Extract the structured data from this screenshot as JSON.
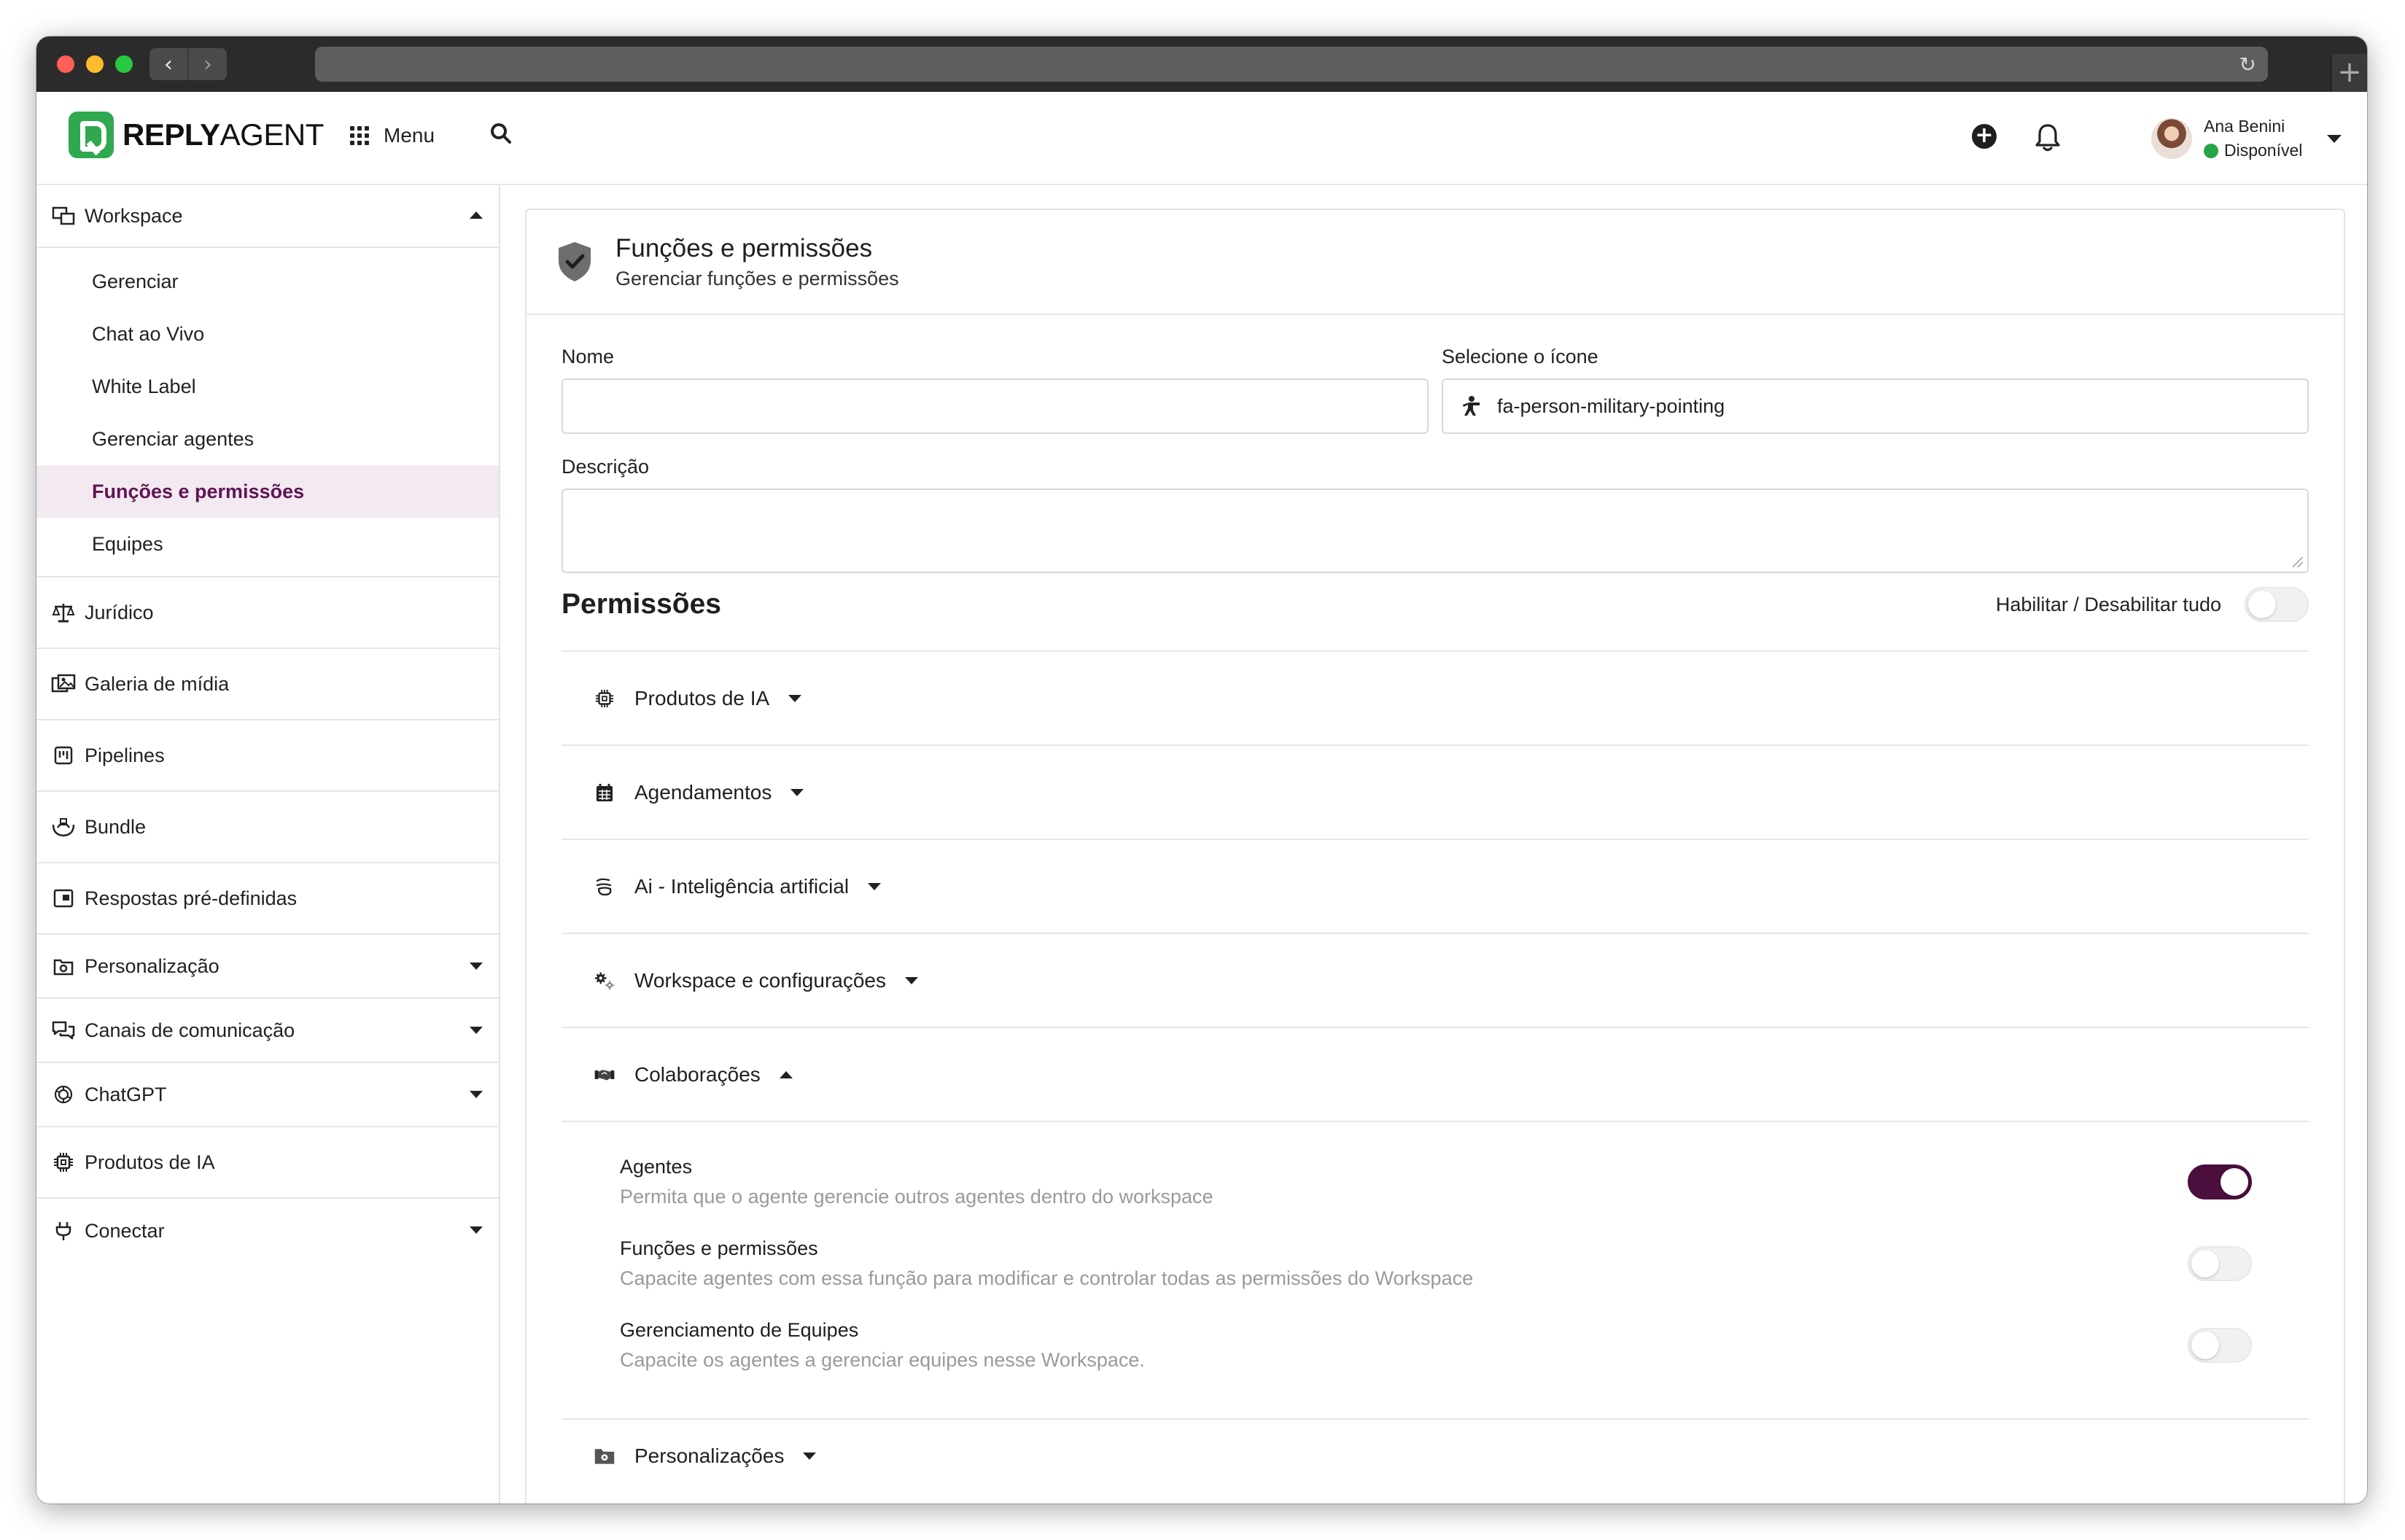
{
  "browser": {
    "back": "‹",
    "forward": "›",
    "reload": "↻",
    "new_tab": "+"
  },
  "header": {
    "brand_bold": "REPLY",
    "brand_light": "AGENT",
    "menu_label": "Menu",
    "user_name": "Ana Benini",
    "user_status": "Disponível",
    "status_color": "#27a445"
  },
  "sidebar": {
    "workspace": {
      "label": "Workspace",
      "items": [
        "Gerenciar",
        "Chat ao Vivo",
        "White Label",
        "Gerenciar agentes",
        "Funções e permissões",
        "Equipes"
      ],
      "active_item": "Funções e permissões"
    },
    "sections": [
      {
        "label": "Jurídico",
        "icon": "scale-icon"
      },
      {
        "label": "Galeria de mídia",
        "icon": "photo-gallery-icon"
      },
      {
        "label": "Pipelines",
        "icon": "pipeline-icon"
      },
      {
        "label": "Bundle",
        "icon": "bundle-icon"
      },
      {
        "label": "Respostas pré-definidas",
        "icon": "canned-response-icon"
      },
      {
        "label": "Personalização",
        "icon": "customize-icon"
      },
      {
        "label": "Canais de comunicação",
        "icon": "chat-channels-icon"
      },
      {
        "label": "ChatGPT",
        "icon": "openai-icon"
      },
      {
        "label": "Produtos de IA",
        "icon": "chip-icon"
      },
      {
        "label": "Conectar",
        "icon": "plug-icon"
      }
    ]
  },
  "main": {
    "title": "Funções e permissões",
    "subtitle": "Gerenciar funções e permissões",
    "form": {
      "name_label": "Nome",
      "name_value": "",
      "icon_label": "Selecione o ícone",
      "icon_value": "fa-person-military-pointing",
      "description_label": "Descrição",
      "description_value": ""
    },
    "permissions": {
      "title": "Permissões",
      "toggle_all_label": "Habilitar / Desabilitar tudo",
      "toggle_all_on": false,
      "groups": [
        {
          "label": "Produtos de IA",
          "icon": "chip-icon",
          "expanded": false
        },
        {
          "label": "Agendamentos",
          "icon": "calendar-icon",
          "expanded": false
        },
        {
          "label": "Ai - Inteligência artificial",
          "icon": "ai-icon",
          "expanded": false
        },
        {
          "label": "Workspace e configurações",
          "icon": "gears-icon",
          "expanded": false
        },
        {
          "label": "Colaborações",
          "icon": "handshake-icon",
          "expanded": true
        },
        {
          "label": "Personalizações",
          "icon": "folder-gear-icon",
          "expanded": false
        }
      ],
      "colaboracoes_items": [
        {
          "name": "Agentes",
          "description": "Permita que o agente gerencie outros agentes dentro do workspace",
          "enabled": true
        },
        {
          "name": "Funções e permissões",
          "description": "Capacite agentes com essa função para modificar e controlar todas as permissões do Workspace",
          "enabled": false
        },
        {
          "name": "Gerenciamento de Equipes",
          "description": "Capacite os agentes a gerenciar equipes nesse Workspace.",
          "enabled": false
        }
      ]
    }
  },
  "colors": {
    "accent": "#4a0f3d",
    "active_bg": "#f3e9f0",
    "active_text": "#5e1555",
    "brand_green": "#2fa84f"
  }
}
